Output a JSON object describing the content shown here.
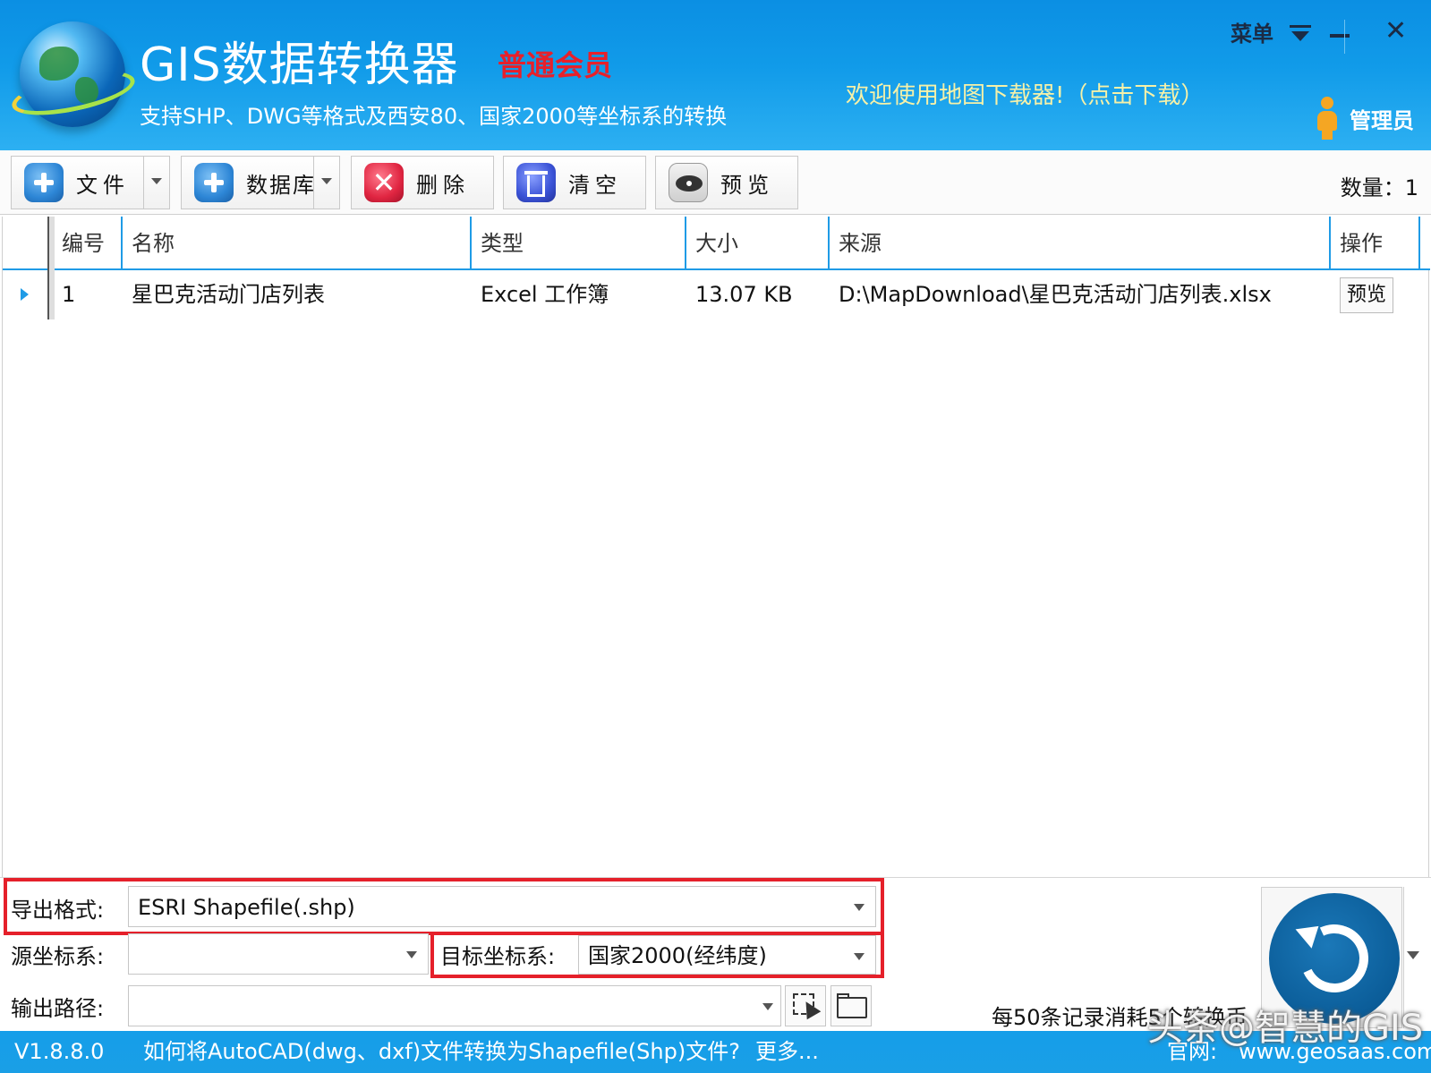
{
  "header": {
    "title": "GIS数据转换器",
    "member_level": "普通会员",
    "subtitle": "支持SHP、DWG等格式及西安80、国家2000等坐标系的转换",
    "welcome": "欢迎使用地图下载器!（点击下载）",
    "menu_label": "菜单",
    "close_glyph": "✕",
    "admin_label": "管理员"
  },
  "toolbar": {
    "file_label": "文件",
    "database_label": "数据库",
    "delete_label": "删除",
    "clear_label": "清空",
    "preview_label": "预览",
    "delete_glyph": "✕",
    "count": "数量：1"
  },
  "table": {
    "columns": [
      "编号",
      "名称",
      "类型",
      "大小",
      "来源",
      "操作"
    ],
    "rows": [
      {
        "id": "1",
        "name": "星巴克活动门店列表",
        "type": "Excel 工作簿",
        "size": "13.07 KB",
        "source": "D:\\MapDownload\\星巴克活动门店列表.xlsx",
        "action": "预览"
      }
    ]
  },
  "form": {
    "export_format_label": "导出格式:",
    "export_format_value": "ESRI Shapefile(.shp)",
    "source_crs_label": "源坐标系:",
    "source_crs_value": "",
    "target_crs_label": "目标坐标系:",
    "target_crs_value": "国家2000(经纬度)",
    "output_path_label": "输出路径:",
    "output_path_value": "",
    "info": "每50条记录消耗5个转换币"
  },
  "status": {
    "version": "V1.8.8.0",
    "link": "如何将AutoCAD(dwg、dxf)文件转换为Shapefile(Shp)文件?",
    "more": "更多...",
    "site_label": "官网:",
    "site_url": "www.geosaas.com"
  },
  "watermark": "头条@智慧的GIS",
  "colors": {
    "header_blue": "#119be9",
    "accent_blue": "#1f9be6",
    "highlight_red": "#e5202a",
    "member_red": "#e8202a",
    "welcome_yellow": "#f6f1a8"
  }
}
